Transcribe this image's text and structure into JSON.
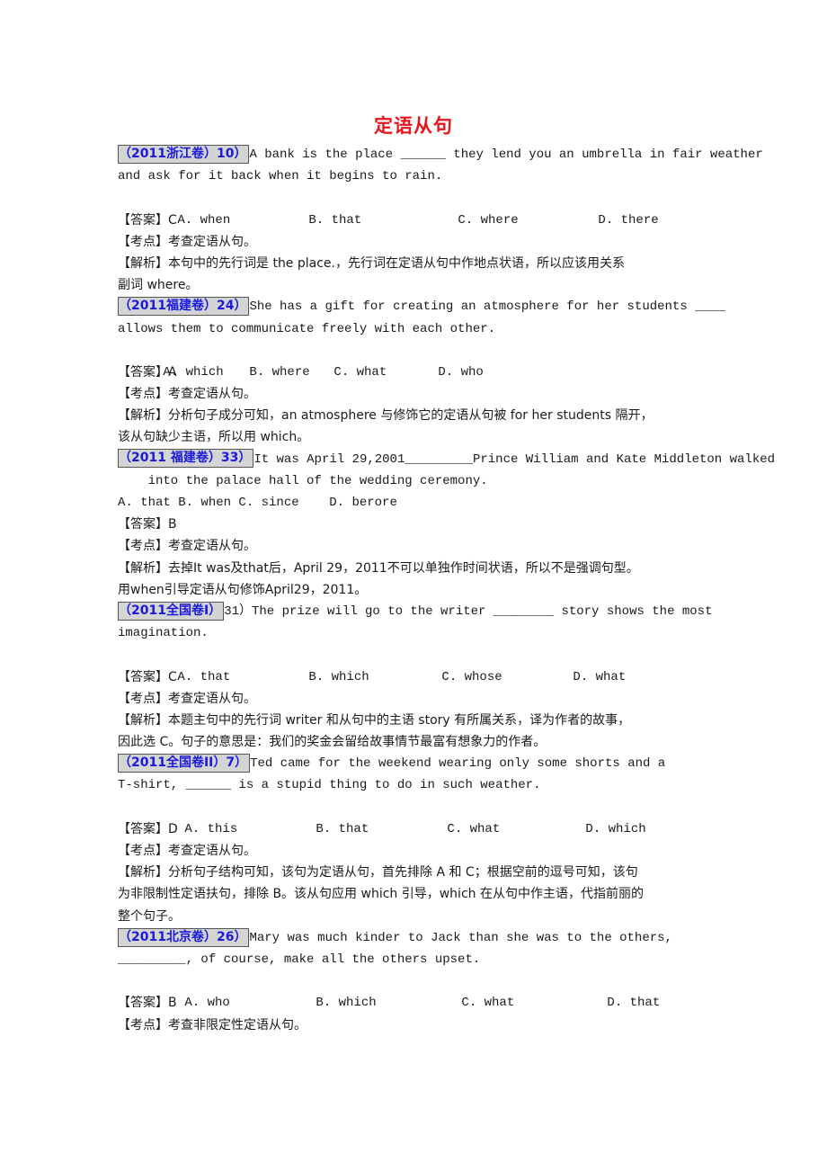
{
  "title": "定语从句",
  "labels": {
    "answer": "【答案】",
    "point": "【考点】",
    "analysis": "【解析】"
  },
  "questions": [
    {
      "tag": "（2011浙江卷）10）",
      "stem_lines": [
        "A bank is the place ______ they lend you an umbrella in fair weather",
        "and ask for it back when it begins to rain."
      ],
      "options": [
        "A. when",
        "B. that",
        "C. where",
        "D. there"
      ],
      "answer": "C",
      "point": "考查定语从句。",
      "analysis_lines": [
        "本句中的先行词是 the place.，先行词在定语从句中作地点状语，所以应该用关系",
        "副词 where。"
      ]
    },
    {
      "tag": "（2011福建卷）24）",
      "stem_lines": [
        "She has a gift for creating an atmosphere for her students ____",
        "allows them to communicate freely with each other."
      ],
      "options": [
        "A. which",
        "B. where",
        "C. what",
        "D. who"
      ],
      "answer": "A",
      "point": "考查定语从句。",
      "analysis_lines": [
        "分析句子成分可知，an atmosphere 与修饰它的定语从句被 for her students 隔开，",
        "该从句缺少主语，所以用 which。"
      ]
    },
    {
      "tag": "（2011 福建卷）33）",
      "stem_lines": [
        "It was April 29,2001_________Prince William and Kate Middleton walked",
        "    into the palace hall of the wedding ceremony."
      ],
      "options": [
        "A. that B. when C. since    D. berore"
      ],
      "answer": "B",
      "point": "考查定语从句。",
      "analysis_lines": [
        "去掉It was及that后，April 29，2011不可以单独作时间状语，所以不是强调句型。",
        "用when引导定语从句修饰April29，2011。"
      ]
    },
    {
      "tag": "（2011全国卷I）",
      "tag_suffix": "31）",
      "stem_lines": [
        "The prize will go to the writer ________ story shows the most",
        "imagination."
      ],
      "options": [
        "A. that",
        "B. which",
        "C. whose",
        "D. what"
      ],
      "answer": "C",
      "point": "考查定语从句。",
      "analysis_lines": [
        "本题主句中的先行词 writer 和从句中的主语 story 有所属关系，译为作者的故事，",
        "因此选 C。句子的意思是：我们的奖金会留给故事情节最富有想象力的作者。"
      ]
    },
    {
      "tag": "（2011全国卷II）7）",
      "stem_lines": [
        "Ted came for the weekend wearing only some shorts and a",
        "T-shirt, ______ is a stupid thing to do in such weather."
      ],
      "options": [
        "A. this",
        "B. that",
        "C. what",
        "D. which"
      ],
      "answer": "D",
      "point": "考查定语从句。",
      "analysis_lines": [
        "分析句子结构可知，该句为定语从句，首先排除 A 和 C；根据空前的逗号可知，该句",
        "为非限制性定语扶句，排除 B。该从句应用 which 引导，which 在从句中作主语，代指前丽的",
        "整个句子。"
      ]
    },
    {
      "tag": "（2011北京卷）26）",
      "stem_lines": [
        "Mary was much kinder to Jack than she was to the others,",
        "_________, of course, make all the others upset."
      ],
      "options": [
        "A. who",
        "B. which",
        "C. what",
        "D. that"
      ],
      "answer": "B",
      "point": "考查非限定性定语从句。"
    }
  ]
}
